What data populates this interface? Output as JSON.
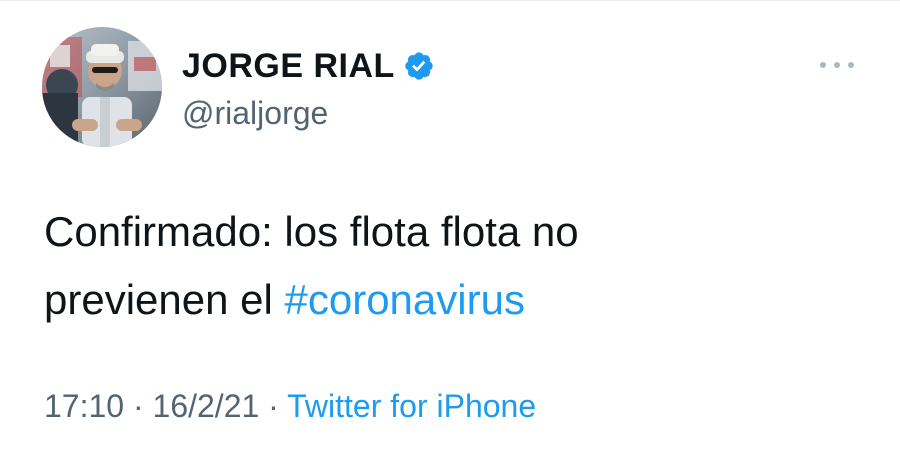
{
  "tweet": {
    "author": {
      "display_name": "JORGE RIAL",
      "handle": "@rialjorge",
      "verified": true,
      "avatar_icon": "profile-photo"
    },
    "text_line1": "Confirmado: los flota flota no",
    "text_line2_prefix": "previenen el ",
    "hashtag": "#coronavirus",
    "time": "17:10",
    "separator1": " · ",
    "date": "16/2/21",
    "separator2": " · ",
    "source": "Twitter for iPhone"
  },
  "colors": {
    "link": "#1d9bf0",
    "text": "#0f1419",
    "secondary": "#536471",
    "verified_badge": "#1d9bf0",
    "more_dots": "#aab8c2"
  }
}
